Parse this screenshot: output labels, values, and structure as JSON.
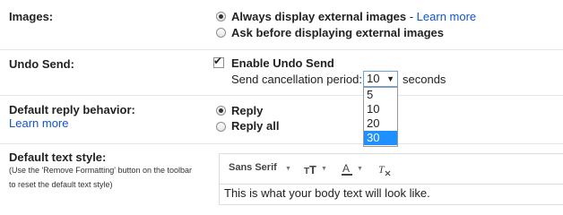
{
  "images": {
    "label": "Images:",
    "options": [
      {
        "text": "Always display external images",
        "checked": true
      },
      {
        "text": "Ask before displaying external images",
        "checked": false
      }
    ],
    "separator": " - ",
    "learn_more": "Learn more"
  },
  "undo_send": {
    "label": "Undo Send:",
    "checkbox_label": "Enable Undo Send",
    "checked": true,
    "period_label": "Send cancellation period:",
    "selected": "10",
    "unit": "seconds",
    "options": [
      "5",
      "10",
      "20",
      "30"
    ],
    "highlighted_option": "30"
  },
  "reply": {
    "label": "Default reply behavior:",
    "learn_more": "Learn more",
    "options": [
      {
        "text": "Reply",
        "checked": true
      },
      {
        "text": "Reply all",
        "checked": false
      }
    ]
  },
  "text_style": {
    "label": "Default text style:",
    "note_line1": "(Use the 'Remove Formatting' button on the toolbar",
    "note_line2": "to reset the default text style)",
    "font_name": "Sans Serif",
    "sample_text": "This is what your body text will look like."
  },
  "icons": {
    "dropdown_caret": "caret-down",
    "font_size": "font-size-icon",
    "text_color": "text-color-icon",
    "remove_format": "remove-formatting-icon"
  }
}
